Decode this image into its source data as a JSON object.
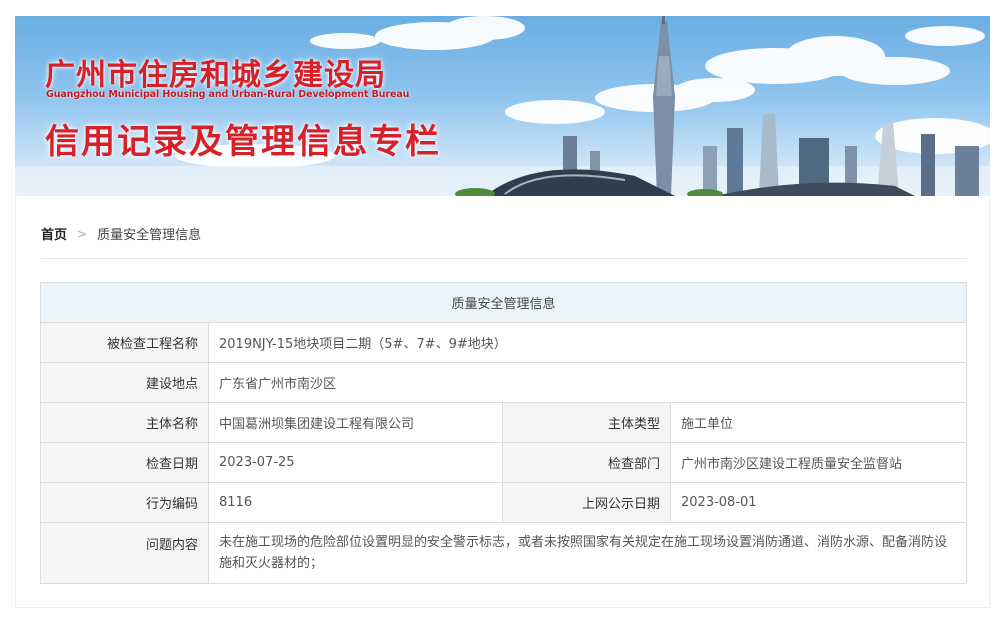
{
  "banner": {
    "title_cn": "广州市住房和城乡建设局",
    "title_en": "Guangzhou Municipal Housing and Urban-Rural Development Bureau",
    "subtitle": "信用记录及管理信息专栏"
  },
  "breadcrumb": {
    "home": "首页",
    "separator": ">",
    "current": "质量安全管理信息"
  },
  "table": {
    "header": "质量安全管理信息",
    "project_name_label": "被检查工程名称",
    "project_name": "2019NJY-15地块项目二期（5#、7#、9#地块）",
    "location_label": "建设地点",
    "location": "广东省广州市南沙区",
    "entity_name_label": "主体名称",
    "entity_name": "中国葛洲坝集团建设工程有限公司",
    "entity_type_label": "主体类型",
    "entity_type": "施工单位",
    "inspection_date_label": "检查日期",
    "inspection_date": "2023-07-25",
    "inspection_dept_label": "检查部门",
    "inspection_dept": "广州市南沙区建设工程质量安全监督站",
    "behavior_code_label": "行为编码",
    "behavior_code": "8116",
    "publish_date_label": "上网公示日期",
    "publish_date": "2023-08-01",
    "issue_label": "问题内容",
    "issue": "未在施工现场的危险部位设置明显的安全警示标志，或者未按照国家有关规定在施工现场设置消防通道、消防水源、配备消防设施和灭火器材的；"
  }
}
